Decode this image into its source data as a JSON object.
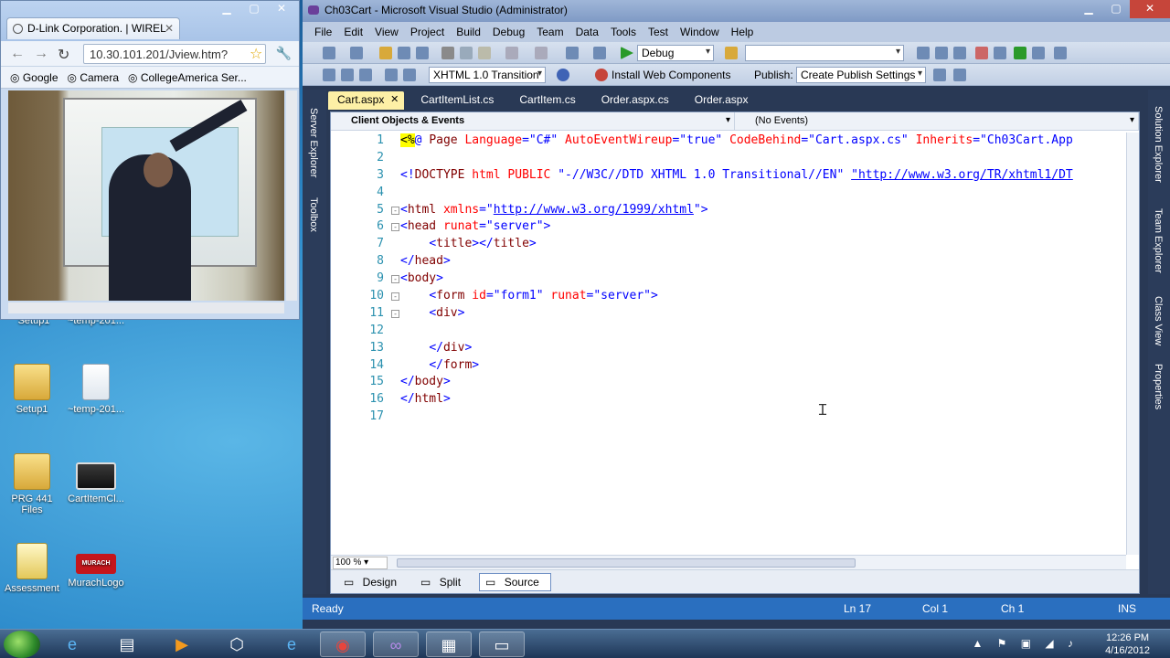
{
  "browser": {
    "tab_title": "D-Link Corporation. | WIREL",
    "url": "10.30.101.201/Jview.htm?",
    "bookmarks": [
      "Google",
      "Camera",
      "CollegeAmerica Ser..."
    ]
  },
  "desktop": {
    "icons": [
      {
        "label": "Setup1",
        "kind": "folder"
      },
      {
        "label": "~temp-201...",
        "kind": "file"
      },
      {
        "label": "PRG 441 Files",
        "kind": "folder"
      },
      {
        "label": "CartItemCl...",
        "kind": "video"
      },
      {
        "label": "Assessment",
        "kind": "doc"
      },
      {
        "label": "MurachLogo",
        "kind": "logo",
        "logo_text": "MURACH"
      }
    ],
    "partial_labels": [
      "Setup1",
      "~temp-201..."
    ]
  },
  "vs": {
    "title": "Ch03Cart - Microsoft Visual Studio (Administrator)",
    "menu": [
      "File",
      "Edit",
      "View",
      "Project",
      "Build",
      "Debug",
      "Team",
      "Data",
      "Tools",
      "Test",
      "Window",
      "Help"
    ],
    "toolbar": {
      "config": "Debug",
      "target": "XHTML 1.0 Transition",
      "install_label": "Install Web Components",
      "publish_label": "Publish:",
      "publish_combo": "Create Publish Settings"
    },
    "left_tabs": [
      "Server Explorer",
      "Toolbox"
    ],
    "right_tabs": [
      "Solution Explorer",
      "Team Explorer",
      "Class View",
      "Properties"
    ],
    "doc_tabs": [
      "Cart.aspx",
      "CartItemList.cs",
      "CartItem.cs",
      "Order.aspx.cs",
      "Order.aspx"
    ],
    "nav_left": "Client Objects & Events",
    "nav_right": "(No Events)",
    "zoom": "100 %",
    "views": [
      "Design",
      "Split",
      "Source"
    ],
    "status": {
      "ready": "Ready",
      "ln": "Ln 17",
      "col": "Col 1",
      "ch": "Ch 1",
      "ins": "INS"
    }
  },
  "code_lines": [
    {
      "n": "1",
      "fold": "",
      "parts": [
        [
          "dir",
          "<%"
        ],
        [
          "bl",
          "@ "
        ],
        [
          "tag",
          "Page "
        ],
        [
          "attr",
          "Language"
        ],
        [
          "bl",
          "=\"C#\" "
        ],
        [
          "attr",
          "AutoEventWireup"
        ],
        [
          "bl",
          "=\"true\" "
        ],
        [
          "attr",
          "CodeBehind"
        ],
        [
          "bl",
          "=\"Cart.aspx.cs\" "
        ],
        [
          "attr",
          "Inherits"
        ],
        [
          "bl",
          "=\"Ch03Cart.App"
        ]
      ]
    },
    {
      "n": "2",
      "fold": "",
      "parts": []
    },
    {
      "n": "3",
      "fold": "",
      "parts": [
        [
          "bl",
          "<!"
        ],
        [
          "tag",
          "DOCTYPE "
        ],
        [
          "attr",
          "html "
        ],
        [
          "attr",
          "PUBLIC "
        ],
        [
          "bl",
          "\"-//W3C//DTD XHTML 1.0 Transitional//EN\" "
        ],
        [
          "link",
          "\"http://www.w3.org/TR/xhtml1/DT"
        ]
      ]
    },
    {
      "n": "4",
      "fold": "",
      "parts": []
    },
    {
      "n": "5",
      "fold": "-",
      "parts": [
        [
          "bl",
          "<"
        ],
        [
          "tag",
          "html "
        ],
        [
          "attr",
          "xmlns"
        ],
        [
          "bl",
          "=\""
        ],
        [
          "link",
          "http://www.w3.org/1999/xhtml"
        ],
        [
          "bl",
          "\">"
        ]
      ]
    },
    {
      "n": "6",
      "fold": "-",
      "parts": [
        [
          "bl",
          "<"
        ],
        [
          "tag",
          "head "
        ],
        [
          "attr",
          "runat"
        ],
        [
          "bl",
          "=\"server\">"
        ]
      ]
    },
    {
      "n": "7",
      "fold": "",
      "parts": [
        [
          "txt",
          "    "
        ],
        [
          "bl",
          "<"
        ],
        [
          "tag",
          "title"
        ],
        [
          "bl",
          "></"
        ],
        [
          "tag",
          "title"
        ],
        [
          "bl",
          ">"
        ]
      ]
    },
    {
      "n": "8",
      "fold": "",
      "parts": [
        [
          "bl",
          "</"
        ],
        [
          "tag",
          "head"
        ],
        [
          "bl",
          ">"
        ]
      ]
    },
    {
      "n": "9",
      "fold": "-",
      "parts": [
        [
          "bl",
          "<"
        ],
        [
          "tag",
          "body"
        ],
        [
          "bl",
          ">"
        ]
      ]
    },
    {
      "n": "10",
      "fold": "-",
      "parts": [
        [
          "txt",
          "    "
        ],
        [
          "bl",
          "<"
        ],
        [
          "tag",
          "form "
        ],
        [
          "attr",
          "id"
        ],
        [
          "bl",
          "=\"form1\" "
        ],
        [
          "attr",
          "runat"
        ],
        [
          "bl",
          "=\"server\">"
        ]
      ]
    },
    {
      "n": "11",
      "fold": "-",
      "parts": [
        [
          "txt",
          "    "
        ],
        [
          "bl",
          "<"
        ],
        [
          "tag",
          "div"
        ],
        [
          "bl",
          ">"
        ]
      ]
    },
    {
      "n": "12",
      "fold": "",
      "parts": []
    },
    {
      "n": "13",
      "fold": "",
      "parts": [
        [
          "txt",
          "    "
        ],
        [
          "bl",
          "</"
        ],
        [
          "tag",
          "div"
        ],
        [
          "bl",
          ">"
        ]
      ]
    },
    {
      "n": "14",
      "fold": "",
      "parts": [
        [
          "txt",
          "    "
        ],
        [
          "bl",
          "</"
        ],
        [
          "tag",
          "form"
        ],
        [
          "bl",
          ">"
        ]
      ]
    },
    {
      "n": "15",
      "fold": "",
      "parts": [
        [
          "bl",
          "</"
        ],
        [
          "tag",
          "body"
        ],
        [
          "bl",
          ">"
        ]
      ]
    },
    {
      "n": "16",
      "fold": "",
      "parts": [
        [
          "bl",
          "</"
        ],
        [
          "tag",
          "html"
        ],
        [
          "bl",
          ">"
        ]
      ]
    },
    {
      "n": "17",
      "fold": "",
      "parts": []
    }
  ],
  "taskbar": {
    "items": [
      "ie-icon",
      "explorer-icon",
      "media-player-icon",
      "virtualbox-icon",
      "ie-icon",
      "chrome-icon",
      "visual-studio-icon",
      "notepad-icon",
      "window-icon"
    ],
    "time": "12:26 PM",
    "date": "4/16/2012"
  }
}
